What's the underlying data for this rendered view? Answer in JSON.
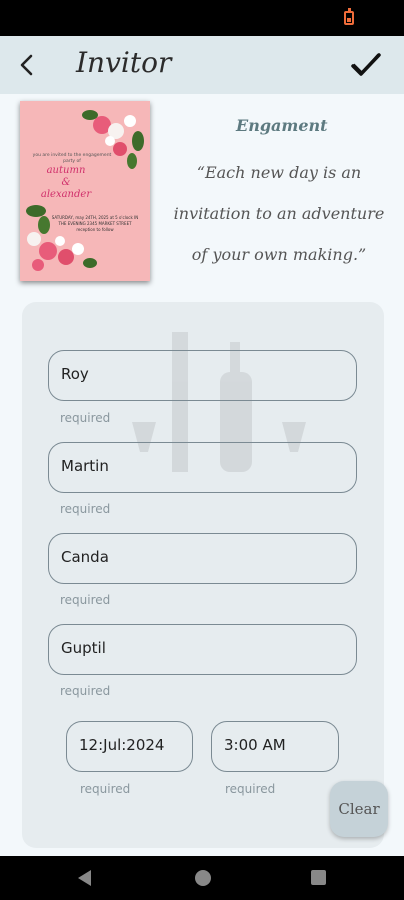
{
  "app": {
    "title": "Invitor"
  },
  "invite_card": {
    "intro": "you are invited to the engagement party of",
    "bride": "autumn",
    "amp": "&",
    "groom": "alexander",
    "details": "SATURDAY, may 24TH, 2025 at 5 o'clock IN THE EVENING 2345 MARKET STREET reception to follow"
  },
  "header": {
    "heading": "Engament",
    "quote": "“Each new day is an invitation to an adventure of your own making.”"
  },
  "form": {
    "first_name": {
      "value": "Roy",
      "helper": "required"
    },
    "last_name": {
      "value": "Martin",
      "helper": "required"
    },
    "field3": {
      "value": "Canda",
      "helper": "required"
    },
    "field4": {
      "value": "Guptil",
      "helper": "required"
    },
    "date": {
      "value": "12:Jul:2024",
      "helper": "required"
    },
    "time": {
      "value": "3:00 AM",
      "helper": "required"
    }
  },
  "actions": {
    "clear_label": "Clear"
  },
  "colors": {
    "app_bar": "#dde8ec",
    "panel": "#e6ecef",
    "card_pink": "#f6b7b8",
    "accent": "#d0306b"
  },
  "icons": {
    "back": "chevron-left-icon",
    "confirm": "check-icon",
    "battery": "battery-icon"
  }
}
